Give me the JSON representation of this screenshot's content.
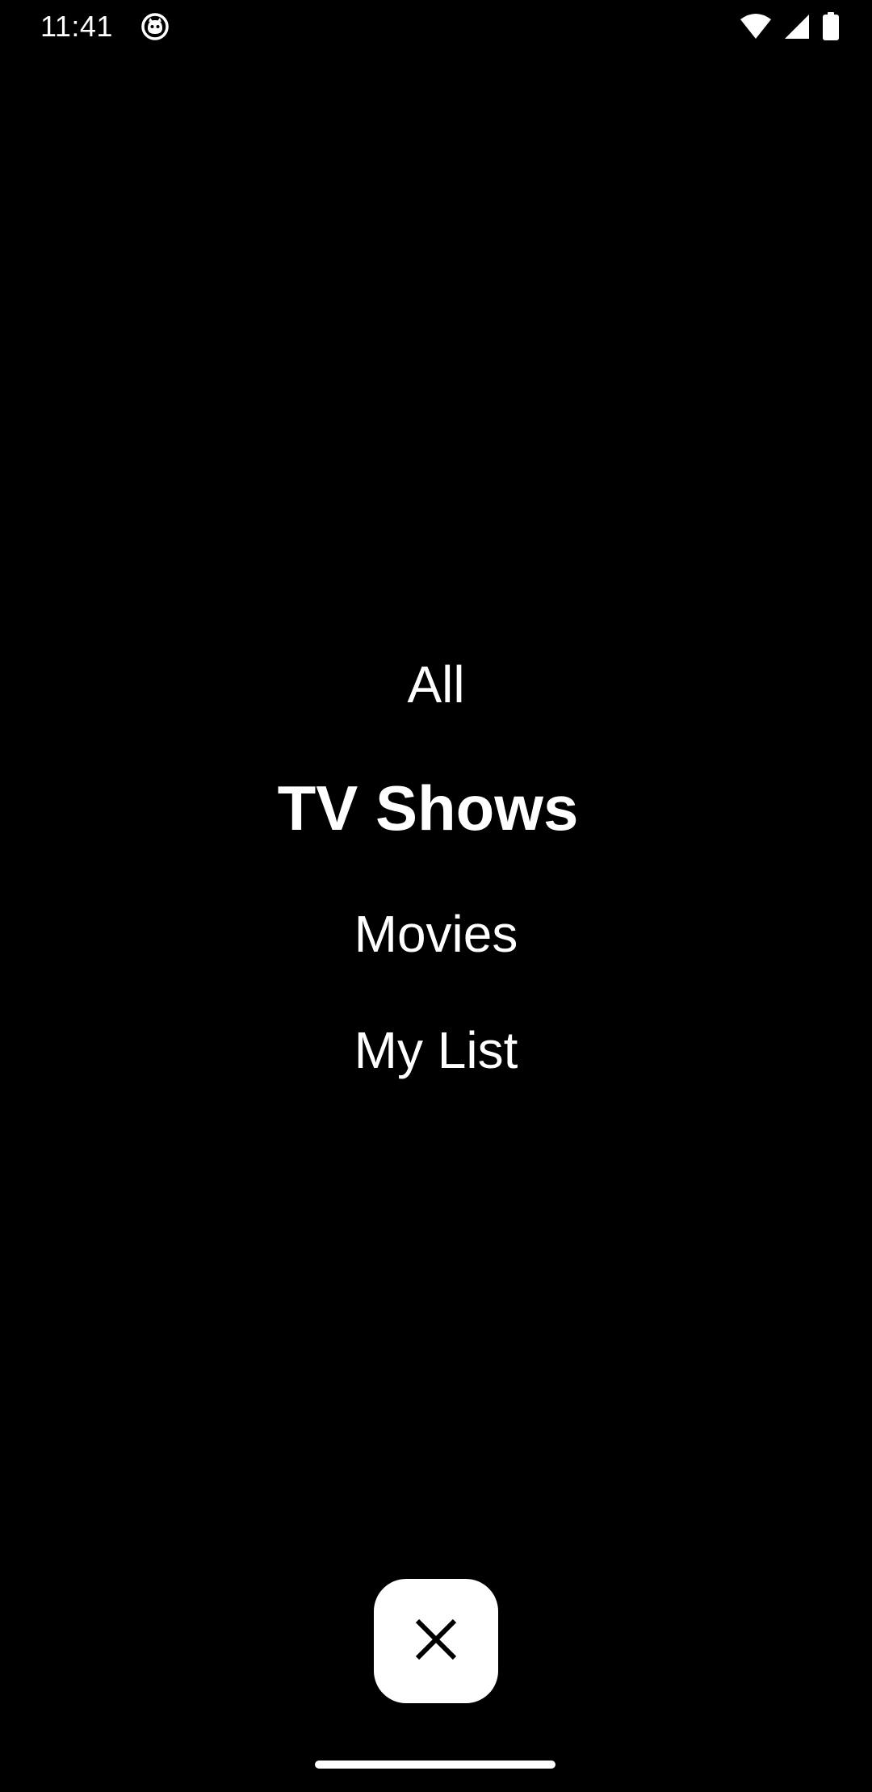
{
  "status_bar": {
    "time": "11:41",
    "icons": [
      "app-notification-icon",
      "wifi-icon",
      "cellular-signal-icon",
      "battery-icon"
    ]
  },
  "menu": {
    "items": [
      {
        "label": "All",
        "selected": false
      },
      {
        "label": "TV Shows",
        "selected": true
      },
      {
        "label": "Movies",
        "selected": false
      },
      {
        "label": "My List",
        "selected": false
      }
    ]
  },
  "close_button": {
    "icon": "close-icon"
  },
  "colors": {
    "background": "#000000",
    "foreground": "#ffffff",
    "close_button_bg": "#ffffff",
    "close_icon": "#000000"
  }
}
